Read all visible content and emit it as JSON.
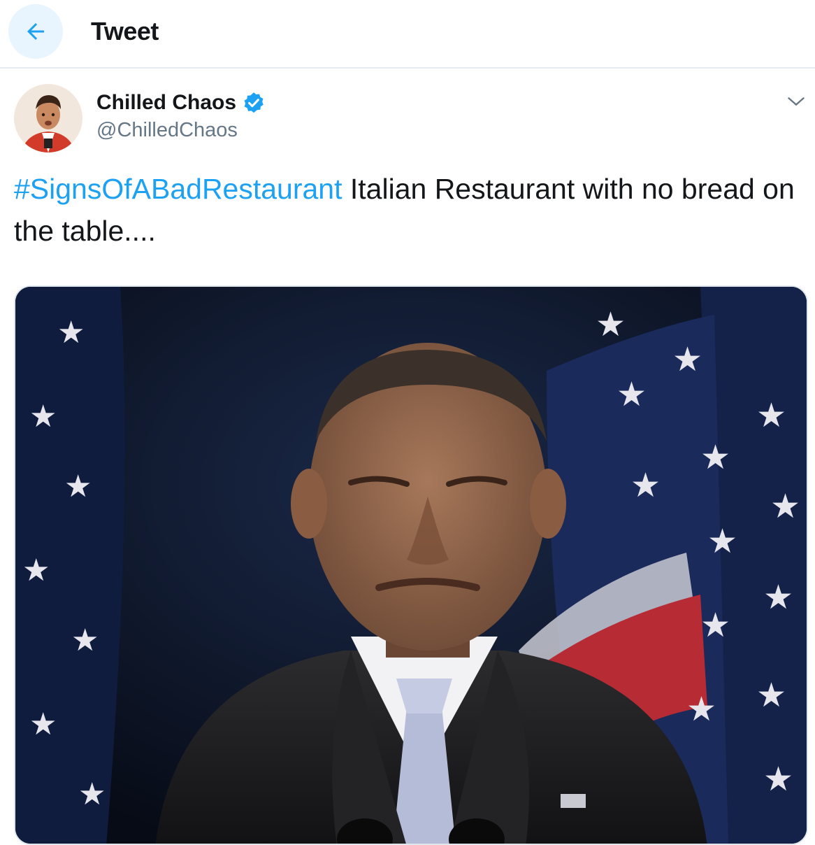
{
  "header": {
    "title": "Tweet",
    "back_icon": "arrow-left-icon"
  },
  "author": {
    "display_name": "Chilled Chaos",
    "handle": "@ChilledChaos",
    "verified_icon": "verified-badge-icon"
  },
  "tweet": {
    "hashtag": "#SignsOfABadRestaurant",
    "text": " Italian Restaurant with no bread on the table...."
  },
  "colors": {
    "accent": "#1da1f2",
    "text": "#14171a",
    "secondary_text": "#657786",
    "back_button_bg": "#e8f5fe"
  }
}
